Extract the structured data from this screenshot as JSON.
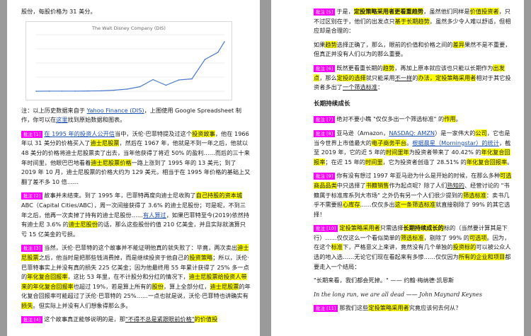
{
  "left": {
    "intro": "股份，每股价格为 31 美分。",
    "chart_title": "The Walt Disney Company (DIS)",
    "note": {
      "pre": "注：以上历史数据来自于 ",
      "link1": "Yahoo Finance (DIS)",
      "mid": "，上图使用 Google Spreadsheet 制作，你可以在",
      "link2": "这里",
      "post": "找到原始数据和图表。"
    },
    "para1": {
      "tag": "批注 [1]",
      "t1": "在 1995 年的投资人公开信",
      "t2": "当中，沃伦·巴菲特提及过这个",
      "t3": "投资故事",
      "t4": "，他在 1966 年以 31 美分的价格买入了",
      "t5": "迪士尼股票",
      "t6": "，然后在 1967 年，他就",
      "t7": "是不到一年之后，他就以 48 美分的价格将迪士尼股票卖了出去，当年他获",
      "t8": "得了将近 50% 的盈利……而后的三十来年时间里，他眼巴巴地看着",
      "t9": "迪士尼股票价格",
      "t10": "一路上涨到了 1995 年的 13 美元；到了 2019 年 10 月，迪士尼股票的价格大约为 129 美元，相当于在 1995 年价格的基础上又翻了差不多 10 倍……"
    },
    "para2": {
      "tag": "批注 [2]",
      "t1": "故事并未结束。到了 1995 年，巴菲特再度向迪士尼收购了",
      "t2": "自己持股的资本城",
      "t3": " ABC（Capital Cities/ABC），周一次间接获得了 3.6% 的迪士尼股份；可是呢，不到三年之后，他再一次卖掉了持有的迪士尼股份……",
      "t4": "有人算过",
      "t5": "，如果巴菲特至今(2019)依然持有迪士尼 3.6% 的",
      "t6": "迪士尼股份",
      "t7": "的话，那么这些股份约值 210 亿美金，并且实际就演算只亏 15 亿美金的亏损。"
    },
    "para3": {
      "tag": "批注 [3]",
      "t1": "当然，沃伦·巴菲特的这个故事并不能证明他真的就失败了：毕竟，两次卖出",
      "t2": "迪士尼股票",
      "t3": "之后，他当时是把那些钱消费掉，而是继续投资于他自己的",
      "t4": "投资策略",
      "t5": "；所以，沃伦·巴菲特事实上并没有真的损失 225 亿美金；因为他最终用 55 年累计获得了 25% 多一点的",
      "t6": "年化复合回报率",
      "t7": "，这比 53 年里，在不计股分和分红的情况下，",
      "t8": "迪士尼股票",
      "t9": "给投资人带来的",
      "t10": "年化复合回报率",
      "t11": "也超过 19%，若是算上所有的",
      "t12": "股份",
      "t13": "，算上全部分红，",
      "t14": "迪士尼股票",
      "t15": "的年化复合回报率可能超过了沃伦·巴菲特的 25%……一点也就是说，沃伦·巴菲特也讲确实有",
      "t16": "损失",
      "t17": "。但实际上并没有人们想象得那么多。"
    },
    "para4": {
      "tag": "批注 [4]",
      "t1": "这个故事真正能够说明的是，那",
      "t2": "\"不得不总是紧跟眼前价格\"",
      "t3": "的价值投"
    }
  },
  "right": {
    "para1": {
      "tag": "批注 [5]",
      "t1": "于是，",
      "t2": "定投策略采用者更看重趋势",
      "t3": "，虽然他们同样是",
      "t4": "价值投资者",
      "t5": "，只不过区别在于，他们的出发点只",
      "t6": "基于长期趋势",
      "t7": "，虽然多少令人难以舒适，但相应却是合理的："
    },
    "para2": {
      "t1": "如果",
      "t2": "趋势",
      "t3": "选择正确了，那么，眼前的价值和价格之间的",
      "t4": "差异",
      "t5": "果然不是不重要，但真正并没有人们以为的那么重要。"
    },
    "para3": {
      "tag": "批注 [6]",
      "t1": "既然更看重长期的",
      "t2": "趋势",
      "t3": "，再加上原本就应该也只能以长期作为",
      "t4": "出发点",
      "t5": "，那么",
      "t6": "定投的选择",
      "t7": "就只能采用",
      "t8": "不一样",
      "t9": "的",
      "t10": "办法",
      "t11": "，定投策略采用者",
      "t12": "相对于其它投资者多出了",
      "t13": "一个筛选标准",
      "t14": "："
    },
    "heading": "长期持续成长",
    "para4": {
      "tag": "批注 [7]",
      "t1": "绝对不要小瞧 \"仅仅多出一个筛选标准\" 的",
      "t2": "作用",
      "t3": "。"
    },
    "para5": {
      "tag": "批注 [8]",
      "t1": "亚马逊（Amazon，",
      "t2": "NASDAQ: AMZN",
      "t3": "）是一家伟大的",
      "t4": "公司",
      "t5": "，它也是当今世界上市值最大的",
      "t6": "电子商务平台",
      "t7": "。",
      "t8": "根据晨星（Morningstar）的统计",
      "t9": "，截至 2019 年，它的近 5 年的",
      "t10": "时间里年",
      "t11": "为投资者带来了 40.42% 的",
      "t12": "年化复合回报率",
      "t13": "；在近 15 年的",
      "t14": "时间里",
      "t15": "，它为投资者创造了 28.51% 的",
      "t16": "年化复合回报率",
      "t17": "。"
    },
    "para6": {
      "tag": "批注 [9]",
      "t1": "你有没有想过 1997 年亚马逊为什么是开始的时候，在那么多种",
      "t2": "可选商品品类",
      "t3": "中只选择了",
      "t4": "书籍销售",
      "t5": "作为起点呢？除了人们",
      "t6": "熟知的",
      "t7": "、经营讨论的 \"书籍属于标准库系列大市场\" 之外仍有另一个人们很少提到的",
      "t8": "筛选标准",
      "t9": "：卖书几乎不需要担",
      "t10": "心库存",
      "t11": "……仅仅多出",
      "t12": "这一条筛选标准",
      "t13": "就直接剔除了 99% 的其它选择！"
    },
    "para7": {
      "tag": "批注 [10]",
      "t1": "定投策略采用者",
      "t2": "只需选择",
      "t3": "长期持续成长的",
      "t4": "标的（当然要计算其是下行）……仅仅这么一个看似简单的",
      "t5": "筛选标准",
      "t6": "，剔除了 99% 的",
      "t7": "可选项",
      "t8": "。因为，在这个",
      "t9": "标准",
      "t10": "下，严格意义上来讲，竟然没有几个单独的",
      "t11": "投资标的",
      "t12": "可以被公众人选的地入选……无论它们现在看起来有多惨……仅仅因为",
      "t13": "所有的企业和项目",
      "t14": "都要走入一个结局："
    },
    "quote_cn": "\"长期来看，我们都会死掉。\" —— 约翰·梅纳德·凯恩斯",
    "quote_en": "In the long run, we are all dead —— John Maynard Keynes",
    "para8": {
      "tag": "批注 [11]",
      "t1": "那我们这些",
      "t2": "定投策略采用者",
      "t3": "究竟应该何去何从？"
    }
  },
  "chart_data": {
    "type": "line",
    "title": "The Walt Disney Company (DIS)",
    "xlabel": "",
    "ylabel": "",
    "x": [
      1962,
      1966,
      1970,
      1974,
      1978,
      1982,
      1986,
      1990,
      1994,
      1998,
      2002,
      2006,
      2010,
      2014,
      2018,
      2020
    ],
    "y": [
      0.1,
      0.3,
      0.5,
      0.5,
      0.8,
      1.2,
      3,
      6,
      13,
      33,
      17,
      32,
      35,
      90,
      110,
      140
    ],
    "ylim": [
      0,
      160
    ],
    "grid": true,
    "line_color": "#4a7bd0"
  }
}
